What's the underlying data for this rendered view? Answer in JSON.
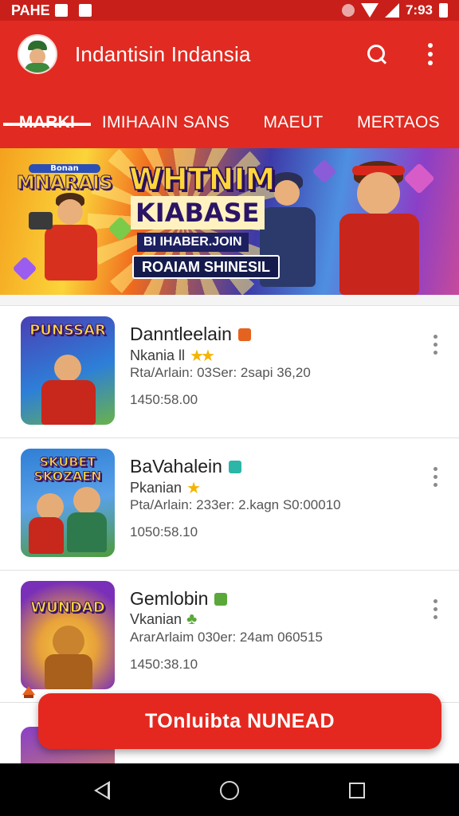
{
  "status_bar": {
    "left_text": "PAHE",
    "time": "7:93"
  },
  "app_bar": {
    "title": "Indantisin Indansia",
    "tabs": [
      {
        "label": "MARKI",
        "active": true
      },
      {
        "label": "IMIHAAIN SANS",
        "active": false
      },
      {
        "label": "MAEUT",
        "active": false
      },
      {
        "label": "MERTAOS",
        "active": false
      }
    ]
  },
  "banner": {
    "logo_small": "Bonan",
    "logo_title": "MNARAIS",
    "headline_line1": "WHTNIM",
    "headline_line2": "KIABASE",
    "subtitle_line1": "BI IHABER.JOIN",
    "subtitle_line2": "ROAIAM SHINESIL"
  },
  "apps": [
    {
      "thumb_title": "PUNSSAR",
      "name": "Danntleelain",
      "developer": "Nkania ll",
      "meta": "Rta/Arlain: 03Ser: 2sapi 36,20",
      "size": "1450:58.00",
      "badge_color": "#e5621f",
      "thumb_colors": [
        "#4a3fb4",
        "#2d7fd8",
        "#6ab24a"
      ]
    },
    {
      "thumb_title": "SKUBET SKOZAEN",
      "name": "BaVahalein",
      "developer": "Pkanian",
      "meta": "Pta/Arlain: 233er: 2.kagn S0:00010",
      "size": "1050:58.10",
      "badge_color": "#2bb6a8",
      "thumb_colors": [
        "#2f7fd6",
        "#5aa1e8",
        "#4e9b3c"
      ]
    },
    {
      "thumb_title": "WUNDAD",
      "name": "Gemlobin",
      "developer": "Vkanian",
      "meta": "ArarArlaim 030er: 24am 060515",
      "size": "1450:38.10",
      "badge_color": "#5aa83a",
      "thumb_colors": [
        "#7a2fb8",
        "#e8a23a",
        "#f4c542"
      ]
    }
  ],
  "primary_action": {
    "label": "TOnluibta NUNEAD"
  },
  "colors": {
    "primary": "#e12a21",
    "status_bar": "#c81f1a",
    "star": "#f4b400"
  }
}
